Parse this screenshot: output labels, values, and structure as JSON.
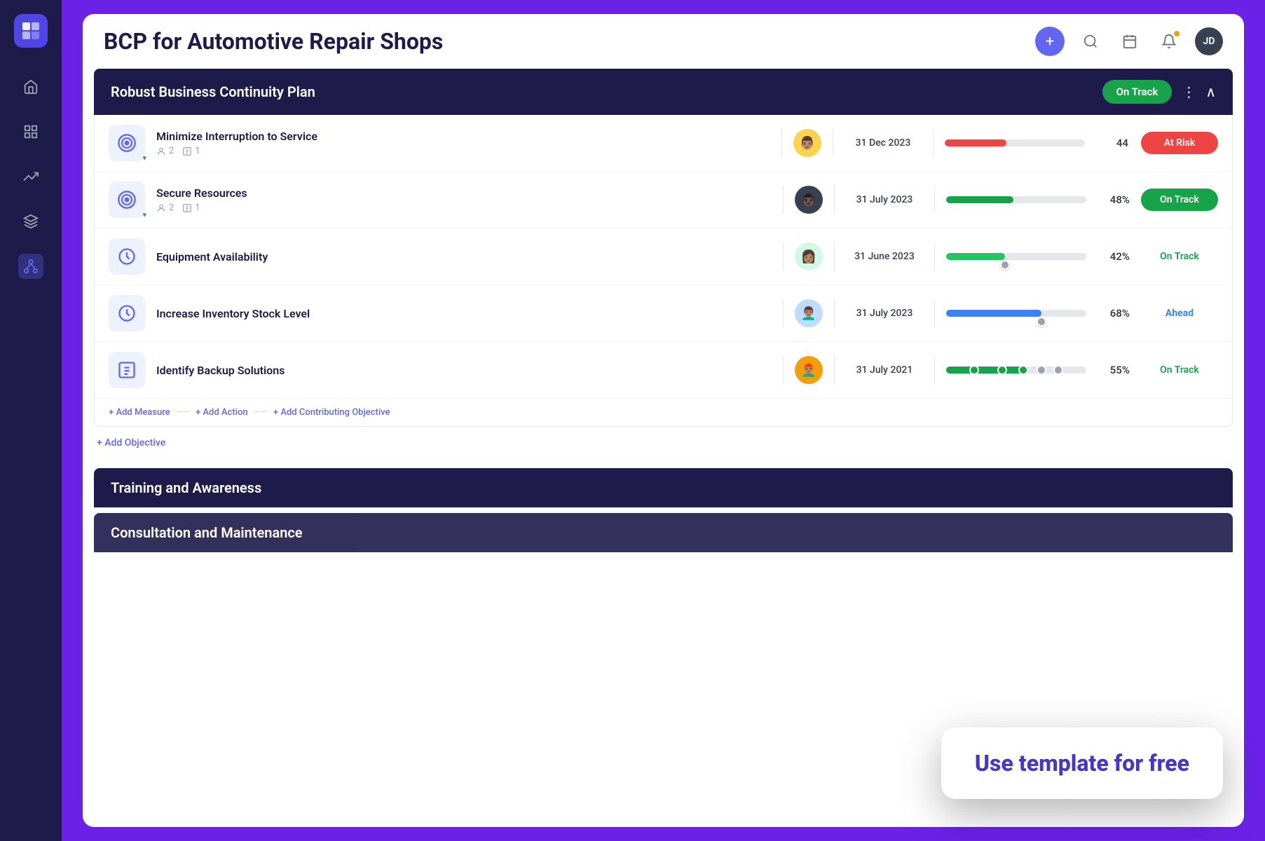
{
  "app": {
    "title": "BCP for Automotive Repair Shops"
  },
  "header": {
    "add_label": "+",
    "user_initials": "JD"
  },
  "sidebar": {
    "icons": [
      "grid",
      "home",
      "chart",
      "trending",
      "layers",
      "network"
    ]
  },
  "section1": {
    "title": "Robust Business Continuity Plan",
    "status": "On Track",
    "objectives": [
      {
        "name": "Minimize Interruption to Service",
        "assignees": "2",
        "tasks": "1",
        "date": "31 Dec 2023",
        "progress": 44,
        "progress_color": "red",
        "status_label": "At Risk",
        "status_type": "at-risk"
      },
      {
        "name": "Secure Resources",
        "assignees": "2",
        "tasks": "1",
        "date": "31 July 2023",
        "progress": 48,
        "progress_color": "green",
        "status_label": "On Track",
        "status_type": "on-track-filled"
      },
      {
        "name": "Equipment Availability",
        "assignees": "",
        "tasks": "",
        "date": "31 June 2023",
        "progress": 42,
        "progress_color": "green-light",
        "status_label": "On Track",
        "status_type": "on-track-text"
      },
      {
        "name": "Increase Inventory Stock Level",
        "assignees": "",
        "tasks": "",
        "date": "31 July 2023",
        "progress": 68,
        "progress_color": "blue",
        "status_label": "Ahead",
        "status_type": "ahead"
      },
      {
        "name": "Identify Backup Solutions",
        "assignees": "",
        "tasks": "",
        "date": "31 July 2021",
        "progress": 55,
        "progress_color": "green",
        "status_label": "On Track",
        "status_type": "on-track-text",
        "multi_dot": true
      }
    ],
    "add_measure": "+ Add Measure",
    "add_action": "+ Add Action",
    "add_contributing": "+ Add Contributing Objective",
    "add_objective": "+ Add Objective"
  },
  "section2": {
    "title": "Training and Awareness"
  },
  "section3": {
    "title": "Consultation and Maintenance"
  },
  "cta": {
    "label": "Use template for free"
  }
}
